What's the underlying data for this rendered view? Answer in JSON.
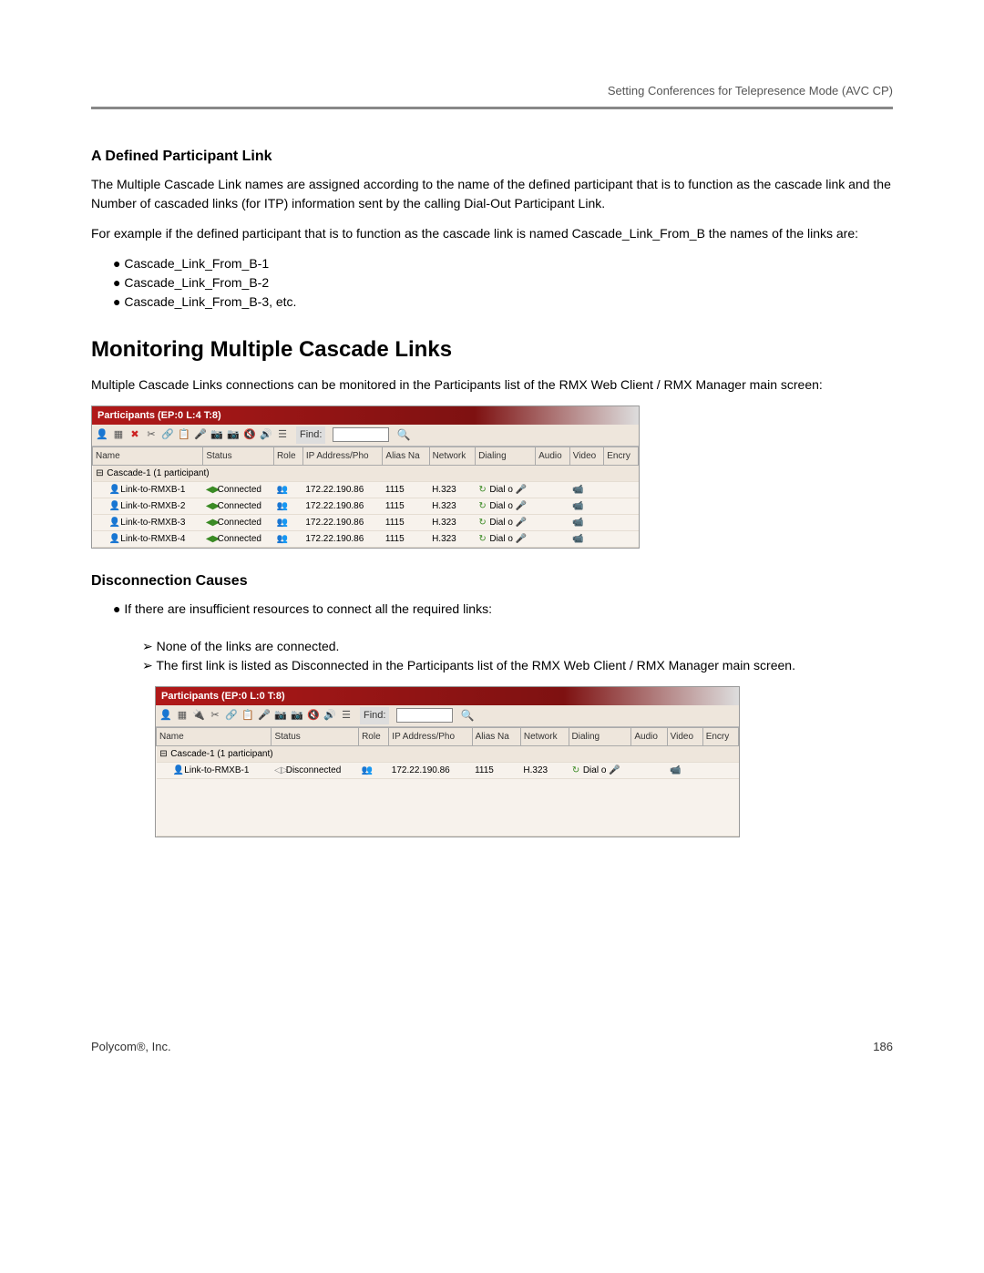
{
  "header": {
    "line": "Setting Conferences for Telepresence Mode (AVC CP)"
  },
  "sec1": {
    "heading": "A Defined Participant Link",
    "p1": "The Multiple Cascade Link names are assigned according to the name of the defined participant that is to function as the cascade link and the Number of cascaded links (for ITP) information sent by the calling Dial-Out Participant Link.",
    "p2": "For example if the defined participant that is to function as the cascade link is named Cascade_Link_From_B the names of the links are:",
    "bullets": [
      "Cascade_Link_From_B-1",
      "Cascade_Link_From_B-2",
      "Cascade_Link_From_B-3, etc."
    ]
  },
  "sec2": {
    "heading": "Monitoring Multiple Cascade Links",
    "p1": "Multiple Cascade Links connections can be monitored in the Participants list of the RMX Web Client / RMX Manager main screen:"
  },
  "panel1": {
    "title": "Participants (EP:0 L:4 T:8)",
    "find_label": "Find:",
    "columns": [
      "Name",
      "Status",
      "Role",
      "IP Address/Pho",
      "Alias Na",
      "Network",
      "Dialing",
      "Audio",
      "Video",
      "Encry"
    ],
    "group": "Cascade-1 (1 participant)",
    "rows": [
      {
        "name": "Link-to-RMXB-1",
        "status": "Connected",
        "ip": "172.22.190.86",
        "alias": "1115",
        "net": "H.323",
        "dial": "Dial o"
      },
      {
        "name": "Link-to-RMXB-2",
        "status": "Connected",
        "ip": "172.22.190.86",
        "alias": "1115",
        "net": "H.323",
        "dial": "Dial o"
      },
      {
        "name": "Link-to-RMXB-3",
        "status": "Connected",
        "ip": "172.22.190.86",
        "alias": "1115",
        "net": "H.323",
        "dial": "Dial o"
      },
      {
        "name": "Link-to-RMXB-4",
        "status": "Connected",
        "ip": "172.22.190.86",
        "alias": "1115",
        "net": "H.323",
        "dial": "Dial o"
      }
    ]
  },
  "sec3": {
    "heading": "Disconnection Causes",
    "b1": "If there are insufficient resources to connect all the required links:",
    "t1": "None of the links are connected.",
    "t2": "The first link is listed as Disconnected in the Participants list of the RMX Web Client / RMX Manager main screen."
  },
  "panel2": {
    "title": "Participants (EP:0 L:0 T:8)",
    "find_label": "Find:",
    "columns": [
      "Name",
      "Status",
      "Role",
      "IP Address/Pho",
      "Alias Na",
      "Network",
      "Dialing",
      "Audio",
      "Video",
      "Encry"
    ],
    "group": "Cascade-1 (1 participant)",
    "rows": [
      {
        "name": "Link-to-RMXB-1",
        "status": "Disconnected",
        "ip": "172.22.190.86",
        "alias": "1115",
        "net": "H.323",
        "dial": "Dial o"
      }
    ]
  },
  "footer": {
    "left": "Polycom®, Inc.",
    "right": "186"
  }
}
